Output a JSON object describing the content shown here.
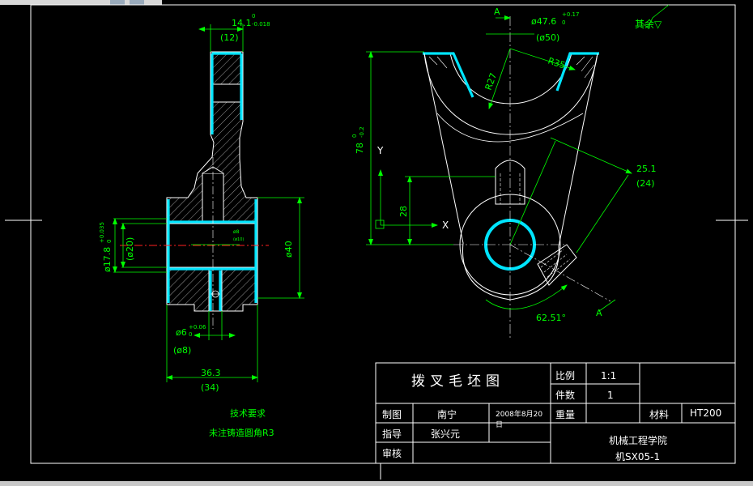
{
  "front_view": {
    "dim_width_top": "14.1",
    "dim_width_top_tol_upper": "0",
    "dim_width_top_tol_lower": "-0.018",
    "dim_width_top_ref": "(12)",
    "dim_bore_dia": "ø17.8",
    "dim_bore_tol_upper": "+0.035",
    "dim_bore_tol_lower": "0",
    "dim_bore_ref": "(ø20)",
    "dim_small_hole": "ø8",
    "dim_small_hole_ref": "(ø10)",
    "dim_outer_dia": "ø40",
    "dim_slot": "ø6",
    "dim_slot_tol_upper": "+0.06",
    "dim_slot_tol_lower": "0",
    "dim_slot_ref": "(ø8)",
    "dim_total_width": "36.3",
    "dim_total_width_ref": "(34)"
  },
  "side_view": {
    "section_label_top": "A",
    "section_label_bottom": "A",
    "dim_arc_dia": "ø47.6",
    "dim_arc_tol_upper": "+0.17",
    "dim_arc_tol_lower": "0",
    "dim_arc_ref": "(ø50)",
    "dim_r35": "R35",
    "dim_r27": "R27",
    "dim_height": "78",
    "dim_height_tol_upper": "0",
    "dim_height_tol_lower": "-0.2",
    "dim_28": "28",
    "dim_25_1": "25.1",
    "dim_25_1_ref": "(24)",
    "dim_angle": "62.51°",
    "axis_y": "Y",
    "axis_x": "X"
  },
  "surface_note": "其余▽",
  "tech_requirements": {
    "title": "技术要求",
    "line1": "未注铸造圆角R3"
  },
  "title_block": {
    "drawing_name": "拨叉毛坯图",
    "scale_label": "比例",
    "scale_value": "1:1",
    "qty_label": "件数",
    "qty_value": "1",
    "weight_label": "重量",
    "material_label": "材料",
    "material_value": "HT200",
    "drawn_label": "制图",
    "drawn_name": "南宁",
    "date": "2008年8月20",
    "date_cont": "日",
    "guide_label": "指导",
    "guide_name": "张兴元",
    "review_label": "审核",
    "school": "机械工程学院",
    "drawing_no": "机SX05-1"
  },
  "colors": {
    "background": "#000000",
    "outline": "#ffffff",
    "dimension": "#00ff00",
    "section": "#00e5ff",
    "centerline": "#ff2020"
  }
}
